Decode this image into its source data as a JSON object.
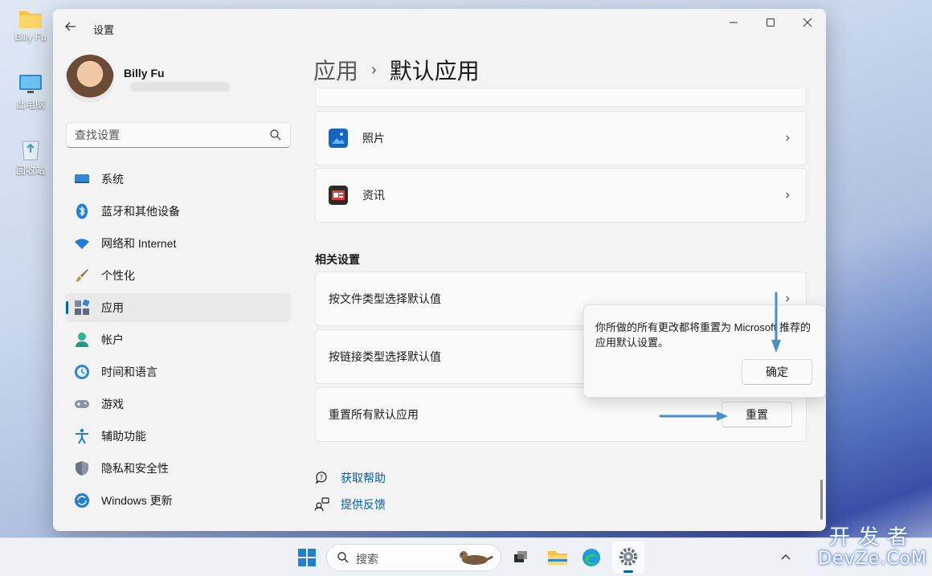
{
  "desktop": {
    "icons": [
      {
        "label": "Billy Fu",
        "icon": "folder-icon"
      },
      {
        "label": "此电脑",
        "icon": "computer-icon"
      },
      {
        "label": "回收站",
        "icon": "recycle-bin-icon"
      }
    ]
  },
  "window": {
    "title": "设置",
    "controls": {
      "minimize": "minimize-icon",
      "maximize": "maximize-icon",
      "close": "close-icon"
    }
  },
  "profile": {
    "name": "Billy Fu"
  },
  "search": {
    "placeholder": "查找设置"
  },
  "nav": {
    "items": [
      {
        "label": "系统",
        "icon": "system-icon"
      },
      {
        "label": "蓝牙和其他设备",
        "icon": "bluetooth-icon"
      },
      {
        "label": "网络和 Internet",
        "icon": "wifi-icon"
      },
      {
        "label": "个性化",
        "icon": "brush-icon"
      },
      {
        "label": "应用",
        "icon": "apps-icon",
        "active": true
      },
      {
        "label": "帐户",
        "icon": "account-icon"
      },
      {
        "label": "时间和语言",
        "icon": "clock-icon"
      },
      {
        "label": "游戏",
        "icon": "gamepad-icon"
      },
      {
        "label": "辅助功能",
        "icon": "accessibility-icon"
      },
      {
        "label": "隐私和安全性",
        "icon": "shield-icon"
      },
      {
        "label": "Windows 更新",
        "icon": "update-icon"
      }
    ]
  },
  "breadcrumb": {
    "parent": "应用",
    "separator": "›",
    "current": "默认应用"
  },
  "apps": [
    {
      "label": "照片",
      "icon": "photos-icon"
    },
    {
      "label": "资讯",
      "icon": "news-icon"
    }
  ],
  "related": {
    "title": "相关设置",
    "items": [
      {
        "label": "按文件类型选择默认值"
      },
      {
        "label": "按链接类型选择默认值"
      },
      {
        "label": "重置所有默认应用",
        "button": "重置"
      }
    ]
  },
  "flyout": {
    "message": "你所做的所有更改都将重置为 Microsoft 推荐的应用默认设置。",
    "confirm": "确定"
  },
  "links": [
    {
      "label": "获取帮助",
      "icon": "help-icon"
    },
    {
      "label": "提供反馈",
      "icon": "feedback-icon"
    }
  ],
  "taskbar": {
    "search_label": "搜索"
  },
  "watermark": {
    "cn": "开发者",
    "en": "DevZe.CoM"
  },
  "colors": {
    "accent": "#005fb8",
    "annotation_arrow": "#4a90c8"
  }
}
